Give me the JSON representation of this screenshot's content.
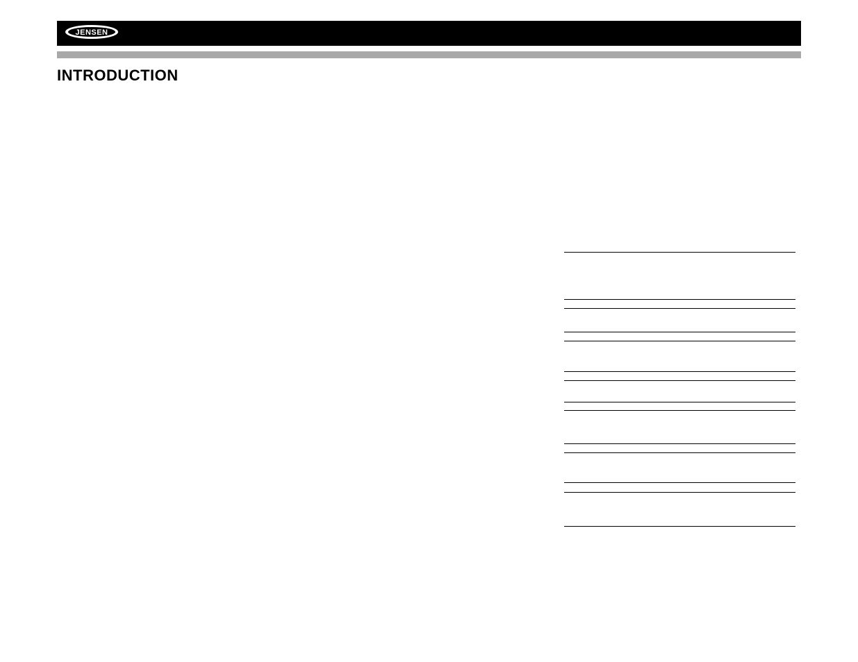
{
  "header": {
    "logo_text": "JENSEN"
  },
  "title": "INTRODUCTION",
  "lines": {
    "positions": [
      241,
      309,
      322,
      356,
      369,
      413,
      426,
      457,
      469,
      517,
      530,
      573,
      587,
      636
    ]
  }
}
